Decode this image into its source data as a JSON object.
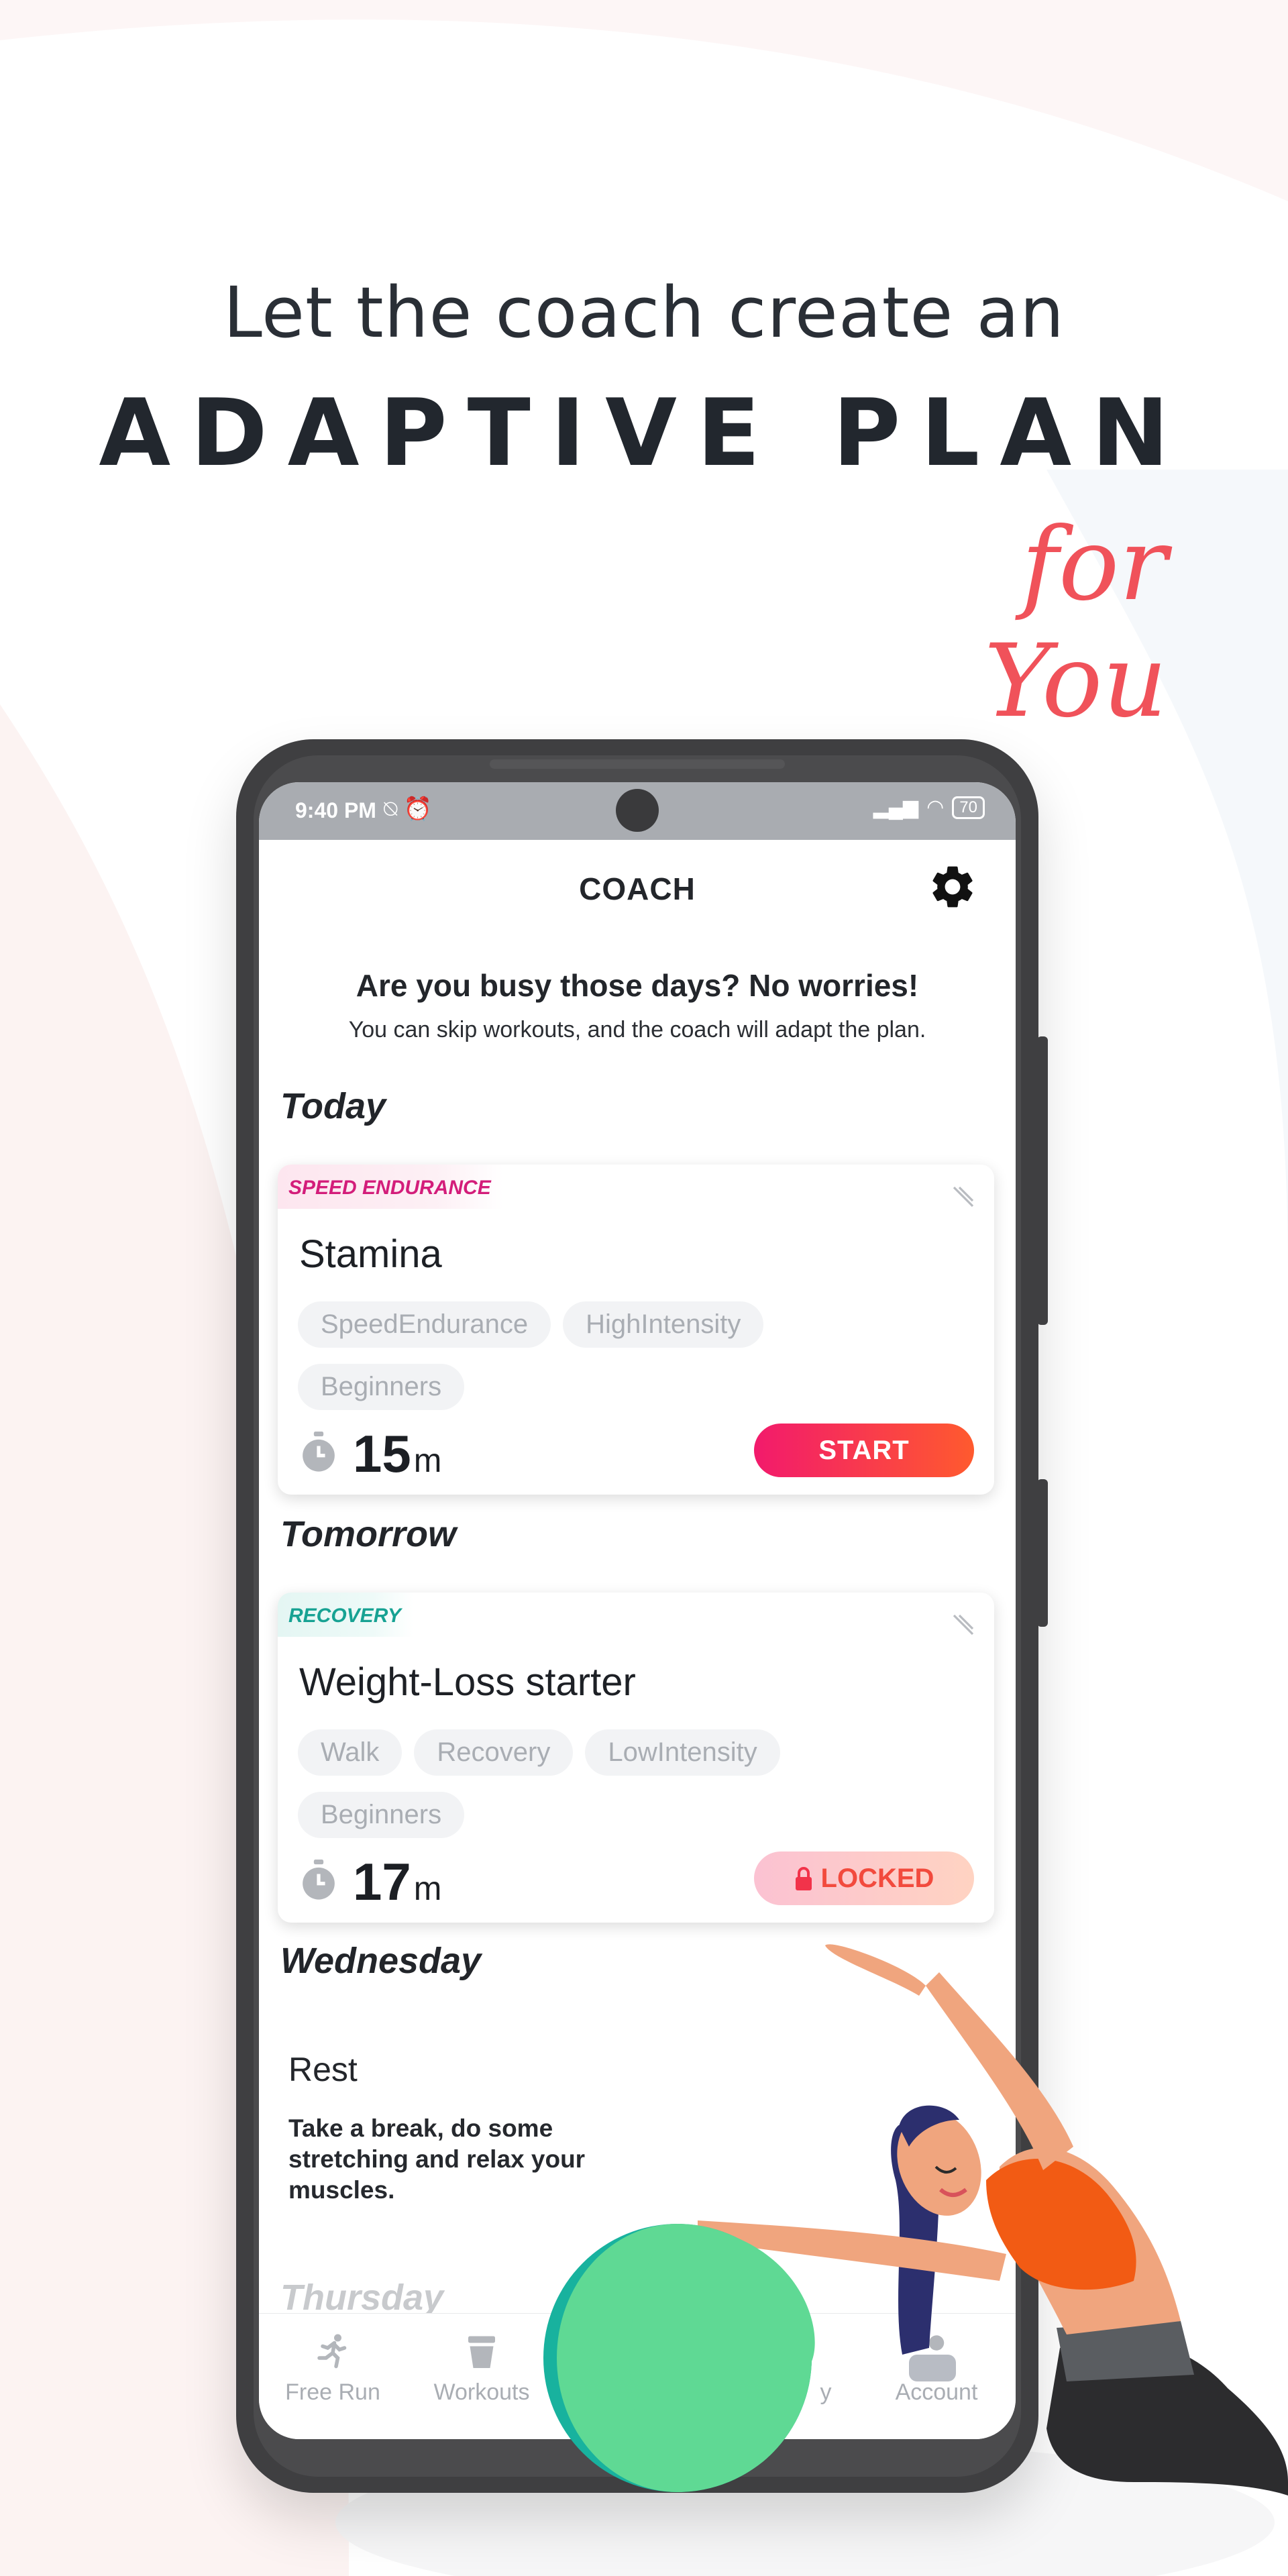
{
  "headline": {
    "line1": "Let the coach create an",
    "line2": "ADAPTIVE PLAN",
    "line3": "for You"
  },
  "status_bar": {
    "time": "9:40 PM",
    "left_icons": "⍉ ⏰",
    "signal": "▂▄▆",
    "wifi": "◠",
    "battery": "70"
  },
  "app": {
    "title": "COACH",
    "settings_icon": "gear-icon"
  },
  "intro": {
    "heading": "Are you busy those days? No worries!",
    "subtext": "You can skip workouts, and the coach will adapt the plan."
  },
  "days": {
    "today": "Today",
    "tomorrow": "Tomorrow",
    "wednesday": "Wednesday",
    "thursday": "Thursday"
  },
  "cards": [
    {
      "type": "SPEED ENDURANCE",
      "title": "Stamina",
      "tags": [
        "SpeedEndurance",
        "HighIntensity",
        "Beginners"
      ],
      "duration": "15",
      "unit": "m",
      "button": "START"
    },
    {
      "type": "RECOVERY",
      "title": "Weight-Loss starter",
      "tags": [
        "Walk",
        "Recovery",
        "LowIntensity",
        "Beginners"
      ],
      "duration": "17",
      "unit": "m",
      "button": "LOCKED"
    }
  ],
  "rest": {
    "title": "Rest",
    "body": "Take a break, do some stretching and relax your muscles."
  },
  "nav": [
    {
      "label": "Free Run",
      "icon": "runner-icon"
    },
    {
      "label": "Workouts",
      "icon": "workouts-icon"
    },
    {
      "label": "y",
      "icon": "history-icon"
    },
    {
      "label": "Account",
      "icon": "account-icon"
    }
  ],
  "colors": {
    "accent_red": "#f0525a",
    "speed_pink": "#d31d7a",
    "recovery_teal": "#17a293",
    "start_gradient_from": "#f21a6c",
    "start_gradient_to": "#ff5a2e"
  }
}
